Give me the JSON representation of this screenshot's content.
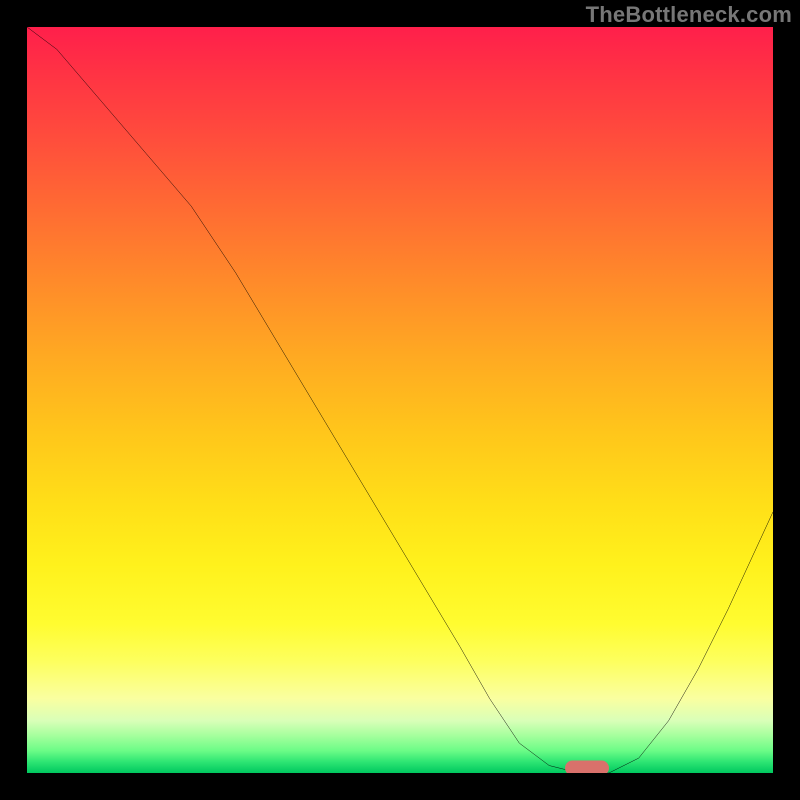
{
  "attribution": "TheBottleneck.com",
  "colors": {
    "frame": "#000000",
    "curve_stroke": "#000000",
    "marker": "#d9716b"
  },
  "chart_data": {
    "type": "line",
    "title": "",
    "xlabel": "",
    "ylabel": "",
    "x_range": [
      0,
      100
    ],
    "y_range": [
      0,
      100
    ],
    "grid": false,
    "legend": false,
    "comment": "No axis ticks or labels are visible; values are estimated from pixel positions on a 0–100 scale. y=100 at top (red ≈ high bottleneck), y=0 at bottom (green ≈ no bottleneck).",
    "series": [
      {
        "name": "bottleneck-curve",
        "x": [
          0,
          4,
          10,
          16,
          22,
          28,
          34,
          40,
          46,
          52,
          58,
          62,
          66,
          70,
          74,
          78,
          82,
          86,
          90,
          94,
          100
        ],
        "y": [
          100,
          97,
          90,
          83,
          76,
          67,
          57,
          47,
          37,
          27,
          17,
          10,
          4,
          1,
          0,
          0,
          2,
          7,
          14,
          22,
          35
        ]
      }
    ],
    "marker": {
      "comment": "Small rounded pink indicator at the curve minimum",
      "x": 75,
      "y": 0
    },
    "background_gradient": {
      "direction": "top-to-bottom",
      "stops": [
        {
          "pos": 0.0,
          "color": "#ff1f4b"
        },
        {
          "pos": 0.5,
          "color": "#ffbf1e"
        },
        {
          "pos": 0.8,
          "color": "#fffc30"
        },
        {
          "pos": 0.95,
          "color": "#a5ff9d"
        },
        {
          "pos": 1.0,
          "color": "#00c85f"
        }
      ]
    }
  }
}
